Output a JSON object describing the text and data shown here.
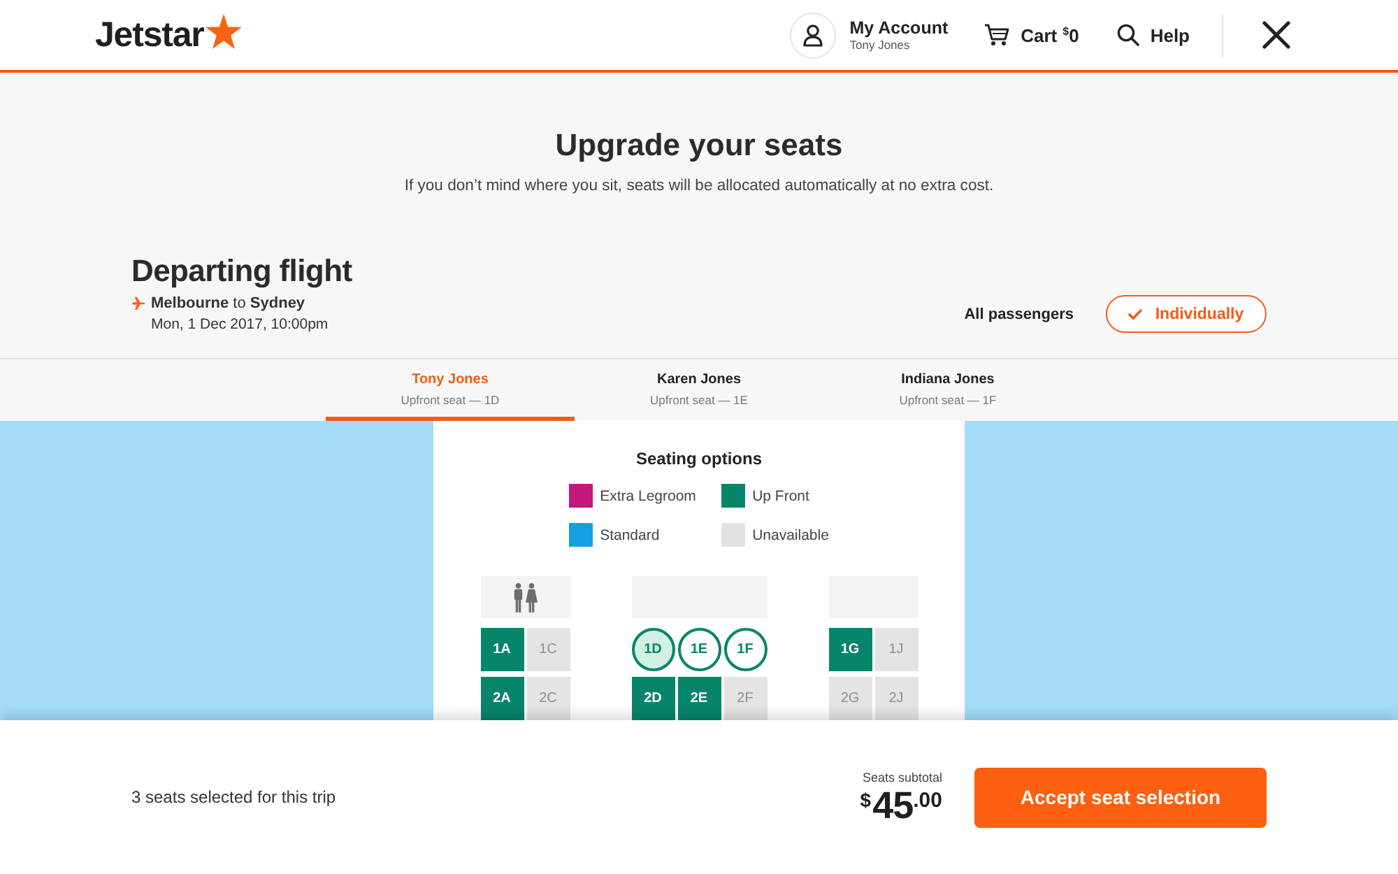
{
  "header": {
    "logo": {
      "text": "Jetstar"
    },
    "account": {
      "label": "My Account",
      "name": "Tony Jones"
    },
    "cart": {
      "label": "Cart",
      "currency": "$",
      "amount": "0"
    },
    "help": {
      "label": "Help"
    }
  },
  "page": {
    "title": "Upgrade your seats",
    "subtitle": "If you don’t mind where you sit, seats will be allocated automatically at no extra cost."
  },
  "flight": {
    "heading": "Departing flight",
    "route": "**Melbourne** to **Sydney**",
    "date": "Mon, 1 Dec 2017, 10:00pm"
  },
  "seat_assignment": {
    "options": [
      {
        "label": "All passengers",
        "selected": false
      },
      {
        "label": "Individually",
        "selected": true
      }
    ]
  },
  "passengers": [
    {
      "name": "Tony Jones",
      "seat": "Upfront seat — 1D",
      "selected": true
    },
    {
      "name": "Karen Jones",
      "seat": "Upfront seat — 1E",
      "selected": false
    },
    {
      "name": "Indiana Jones",
      "seat": "Upfront seat — 1F",
      "selected": false
    }
  ],
  "seating_options": {
    "title": "Seating options",
    "items": [
      {
        "label": "Extra Legroom",
        "color": "#c4177c"
      },
      {
        "label": "Up Front",
        "color": "#07856a"
      },
      {
        "label": "Standard",
        "color": "#16a0e4"
      },
      {
        "label": "Unavailable",
        "color": "#e2e2e2"
      }
    ]
  },
  "seat_map": {
    "sections": [
      {
        "kind": "restroom",
        "rows": [
          {
            "seats": [
              {
                "label": "1A",
                "kind": "up_front",
                "selected": false
              },
              {
                "label": "1C",
                "kind": "unavailable",
                "selected": false
              }
            ]
          },
          {
            "seats": [
              {
                "label": "2A",
                "kind": "up_front",
                "selected": false
              },
              {
                "label": "2C",
                "kind": "unavailable",
                "selected": false
              }
            ]
          }
        ]
      },
      {
        "kind": "blank",
        "rows": [
          {
            "seats": [
              {
                "label": "1D",
                "kind": "assigned",
                "selected": true
              },
              {
                "label": "1E",
                "kind": "assigned",
                "selected": false
              },
              {
                "label": "1F",
                "kind": "assigned",
                "selected": false
              }
            ]
          },
          {
            "seats": [
              {
                "label": "2D",
                "kind": "up_front",
                "selected": false
              },
              {
                "label": "2E",
                "kind": "up_front",
                "selected": false
              },
              {
                "label": "2F",
                "kind": "unavailable",
                "selected": false
              }
            ]
          }
        ]
      },
      {
        "kind": "blank",
        "rows": [
          {
            "seats": [
              {
                "label": "1G",
                "kind": "up_front",
                "selected": false
              },
              {
                "label": "1J",
                "kind": "unavailable",
                "selected": false
              }
            ]
          },
          {
            "seats": [
              {
                "label": "2G",
                "kind": "unavailable",
                "selected": false
              },
              {
                "label": "2J",
                "kind": "unavailable",
                "selected": false
              }
            ]
          }
        ]
      }
    ]
  },
  "footer": {
    "summary": "3 seats selected for this trip",
    "subtotal_label": "Seats subtotal",
    "subtotal": {
      "currency": "$",
      "amount": "45",
      "cents": ".00"
    },
    "button": "Accept seat selection"
  }
}
